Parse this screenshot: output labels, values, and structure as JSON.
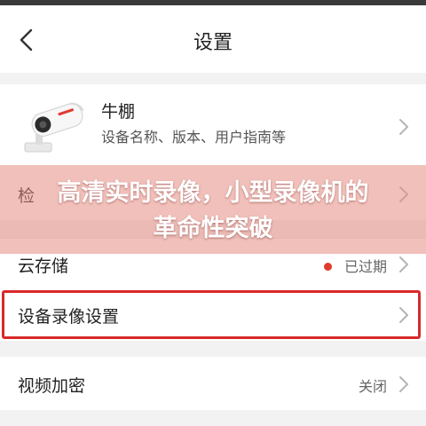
{
  "header": {
    "title": "设置",
    "back_icon": "chevron-left-icon"
  },
  "device": {
    "name": "牛棚",
    "subtitle": "设备名称、版本、用户指南等",
    "icon": "security-camera-icon"
  },
  "rows": {
    "detect": {
      "label": "检"
    },
    "cloud": {
      "label": "云存储",
      "status": "已过期",
      "status_color": "#e23a2e"
    },
    "record": {
      "label": "设备录像设置",
      "highlight_color": "#d9292a"
    },
    "encrypt": {
      "label": "视频加密",
      "value": "关闭"
    }
  },
  "overlay": {
    "line1": "高清实时录像，小型录像机的",
    "line2": "革命性突破"
  }
}
